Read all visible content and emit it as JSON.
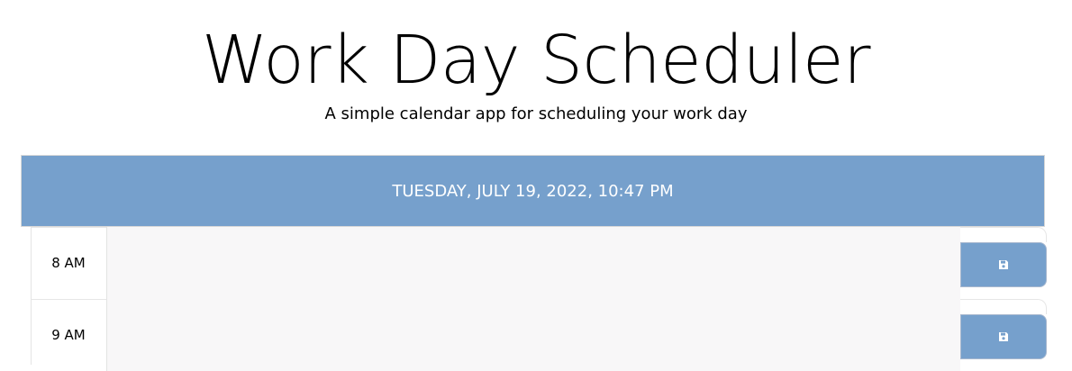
{
  "header": {
    "title": "Work Day Scheduler",
    "subtitle": "A simple calendar app for scheduling your work day"
  },
  "current_date": "TUESDAY, JULY 19, 2022, 10:47 PM",
  "time_blocks": [
    {
      "hour": "8 AM",
      "text": "",
      "save_icon": "save-icon"
    },
    {
      "hour": "9 AM",
      "text": "",
      "save_icon": "save-icon"
    }
  ],
  "colors": {
    "accent": "#76a0cc",
    "textarea_bg": "#f8f7f8",
    "save_icon": "#ffffff"
  }
}
